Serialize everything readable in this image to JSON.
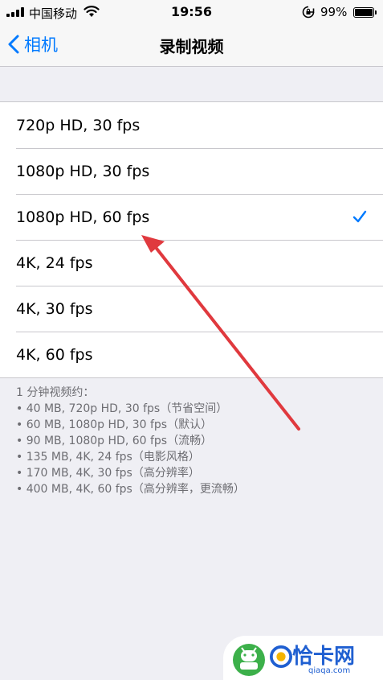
{
  "status_bar": {
    "carrier": "中国移动",
    "time": "19:56",
    "battery_percent": "99%",
    "battery_level": 0.99
  },
  "nav": {
    "back_label": "相机",
    "title": "录制视频"
  },
  "options": [
    {
      "label": "720p HD, 30 fps",
      "selected": false
    },
    {
      "label": "1080p HD, 30 fps",
      "selected": false
    },
    {
      "label": "1080p HD, 60 fps",
      "selected": true
    },
    {
      "label": "4K, 24 fps",
      "selected": false
    },
    {
      "label": "4K, 30 fps",
      "selected": false
    },
    {
      "label": "4K, 60 fps",
      "selected": false
    }
  ],
  "footer": {
    "heading": "1 分钟视频约：",
    "lines": [
      "• 40 MB, 720p HD, 30 fps（节省空间）",
      "• 60 MB, 1080p HD, 30 fps（默认）",
      "• 90 MB, 1080p HD, 60 fps（流畅）",
      "• 135 MB, 4K, 24 fps（电影风格）",
      "• 170 MB, 4K, 30 fps（高分辨率）",
      "• 400 MB, 4K, 60 fps（高分辨率，更流畅）"
    ]
  },
  "watermark": {
    "text": "恰卡网",
    "subtext": "qiaqa.com"
  },
  "colors": {
    "accent": "#007aff",
    "annotation_arrow": "#e0393e"
  }
}
